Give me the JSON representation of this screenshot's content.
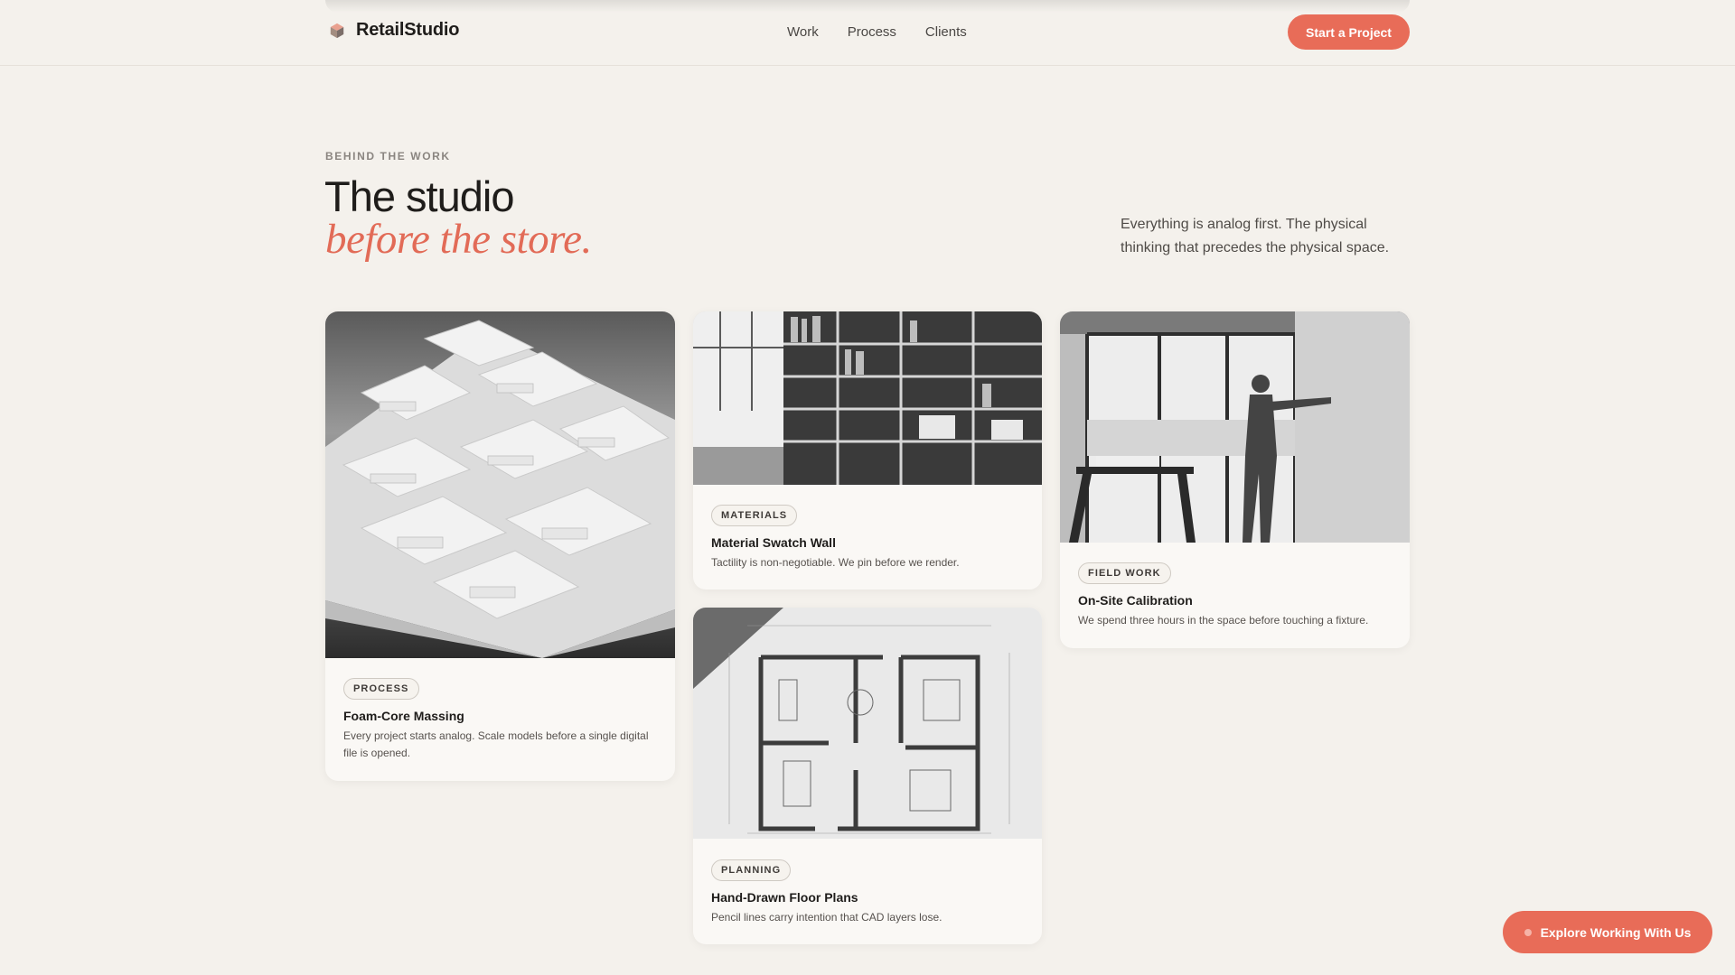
{
  "header": {
    "brand": "RetailStudio",
    "brand_icon": "cube-logo-icon",
    "nav": [
      "Work",
      "Process",
      "Clients"
    ],
    "cta_label": "Start a Project"
  },
  "hero": {
    "eyebrow": "BEHIND THE WORK",
    "title_line1": "The studio",
    "title_line2": "before the store.",
    "intro": "Everything is analog first. The physical thinking that precedes the physical space."
  },
  "cards": [
    {
      "image": "foam-core-model-photo",
      "tag": "PROCESS",
      "title": "Foam-Core Massing",
      "description": "Every project starts analog. Scale models before a single digital file is opened."
    },
    {
      "image": "bookshelf-library-photo",
      "tag": "MATERIALS",
      "title": "Material Swatch Wall",
      "description": "Tactility is non-negotiable. We pin before we render."
    },
    {
      "image": "floor-plan-sketch",
      "tag": "PLANNING",
      "title": "Hand-Drawn Floor Plans",
      "description": "Pencil lines carry intention that CAD layers lose."
    },
    {
      "image": "woman-measuring-wall-photo",
      "tag": "FIELD WORK",
      "title": "On-Site Calibration",
      "description": "We spend three hours in the space before touching a fixture."
    }
  ],
  "floating_cta": {
    "label": "Explore Working With Us"
  },
  "colors": {
    "accent": "#e86c58",
    "background": "#f4f1ec",
    "card": "#faf8f5"
  }
}
